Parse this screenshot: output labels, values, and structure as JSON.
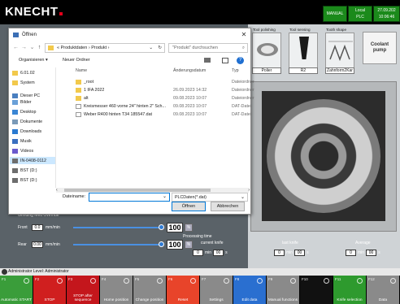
{
  "app": {
    "logo": "KNECHT",
    "mode": "MANUAL",
    "local_label": "Local",
    "plc_label": "PLC",
    "date": "27.09.202",
    "time": "10:06:46"
  },
  "tools": {
    "tool1_title": "Tool polishing",
    "tool1_label": "Polier",
    "tool2_title": "Tool sensing",
    "tool2_label": "R2",
    "tool3_title": "Tooth shape",
    "tool3_label": "Zahnform2Kar",
    "coolant_label": "Coolant pump"
  },
  "feed": {
    "section_title": "Grinding feed Override",
    "front_label": "Front",
    "front_value": "0.0",
    "front_unit": "mm/min",
    "front_pct": "100",
    "rear_label": "Rear",
    "rear_value": "0.00",
    "rear_unit": "mm/min",
    "rear_pct": "100",
    "pct_sign": "%",
    "front_level": 1.0,
    "rear_level": 1.0
  },
  "processing": {
    "title": "Processing time",
    "current_knife": "current knife",
    "last_knife": "last knife",
    "average": "Average",
    "cur_min": "0",
    "cur_sec": "00",
    "last_min": "0",
    "last_sec": "00",
    "avg_min": "0",
    "avg_sec": "00",
    "min_unit": "min",
    "sec_unit": "s"
  },
  "status": {
    "text": "Administrator  Level: Administrator"
  },
  "fkeys": [
    {
      "num": "F1",
      "label": "Automatic START",
      "color": "#3a9d3a"
    },
    {
      "num": "F2",
      "label": "STOP",
      "color": "#d01f1f"
    },
    {
      "num": "F3",
      "label": "STOP after sequence",
      "color": "#c4161c"
    },
    {
      "num": "F4",
      "label": "Home position",
      "color": "#8a8a8a"
    },
    {
      "num": "F5",
      "label": "Change position",
      "color": "#8a8a8a"
    },
    {
      "num": "F6",
      "label": "Reset",
      "color": "#e8442a"
    },
    {
      "num": "F7",
      "label": "Settings",
      "color": "#8a8a8a"
    },
    {
      "num": "F8",
      "label": "Edit data",
      "color": "#2a6fd0"
    },
    {
      "num": "F9",
      "label": "Manual functions",
      "color": "#8a8a8a"
    },
    {
      "num": "F10",
      "label": "",
      "color": "#111111"
    },
    {
      "num": "F11",
      "label": "Knife selection",
      "color": "#2e9a2e"
    },
    {
      "num": "F12",
      "label": "Data",
      "color": "#8a8a8a"
    }
  ],
  "dialog": {
    "title": "Öffnen",
    "close": "✕",
    "breadcrumb": "«  Produktdaten  ›  Produkt  ›",
    "search_placeholder": "\"Produkt\" durchsuchen",
    "organize": "Organisieren ▾",
    "new_folder": "Neuer Ordner",
    "col_name": "Name",
    "col_date": "Änderungsdatum",
    "col_type": "Typ",
    "nav_items": [
      {
        "label": "6.01.02",
        "icon": "folder"
      },
      {
        "label": "System",
        "icon": "folder"
      },
      {
        "label": "Dieser PC",
        "icon": "pc"
      },
      {
        "label": "Bilder",
        "icon": "pictures"
      },
      {
        "label": "Desktop",
        "icon": "desktop"
      },
      {
        "label": "Dokumente",
        "icon": "documents"
      },
      {
        "label": "Downloads",
        "icon": "downloads"
      },
      {
        "label": "Musik",
        "icon": "music"
      },
      {
        "label": "Videos",
        "icon": "videos"
      },
      {
        "label": "IN-0408-0112",
        "icon": "drive"
      },
      {
        "label": "BST (D:)",
        "icon": "drive"
      },
      {
        "label": "BST (D:)",
        "icon": "drive"
      }
    ],
    "files": [
      {
        "name": "_root",
        "date": "",
        "type": "Dateiordner",
        "kind": "folder"
      },
      {
        "name": "1 IFA 2022",
        "date": "26.09.2023 14:32",
        "type": "Dateiordner",
        "kind": "folder"
      },
      {
        "name": "alt",
        "date": "09.08.2023 10:07",
        "type": "Dateiordner",
        "kind": "folder"
      },
      {
        "name": "Kreismesser 460 vorne 24\" hinten 2\" Sch...",
        "date": "09.08.2023 10:07",
        "type": "DAT-Datei",
        "kind": "file"
      },
      {
        "name": "Weber R400 hinten T34 185547.dat",
        "date": "09.08.2023 10:07",
        "type": "DAT-Datei",
        "kind": "file"
      }
    ],
    "filename_label": "Dateiname:",
    "filename_value": "",
    "filetype": "PLCDaten(*.dat)",
    "open_btn": "Öffnen",
    "cancel_btn": "Abbrechen"
  }
}
